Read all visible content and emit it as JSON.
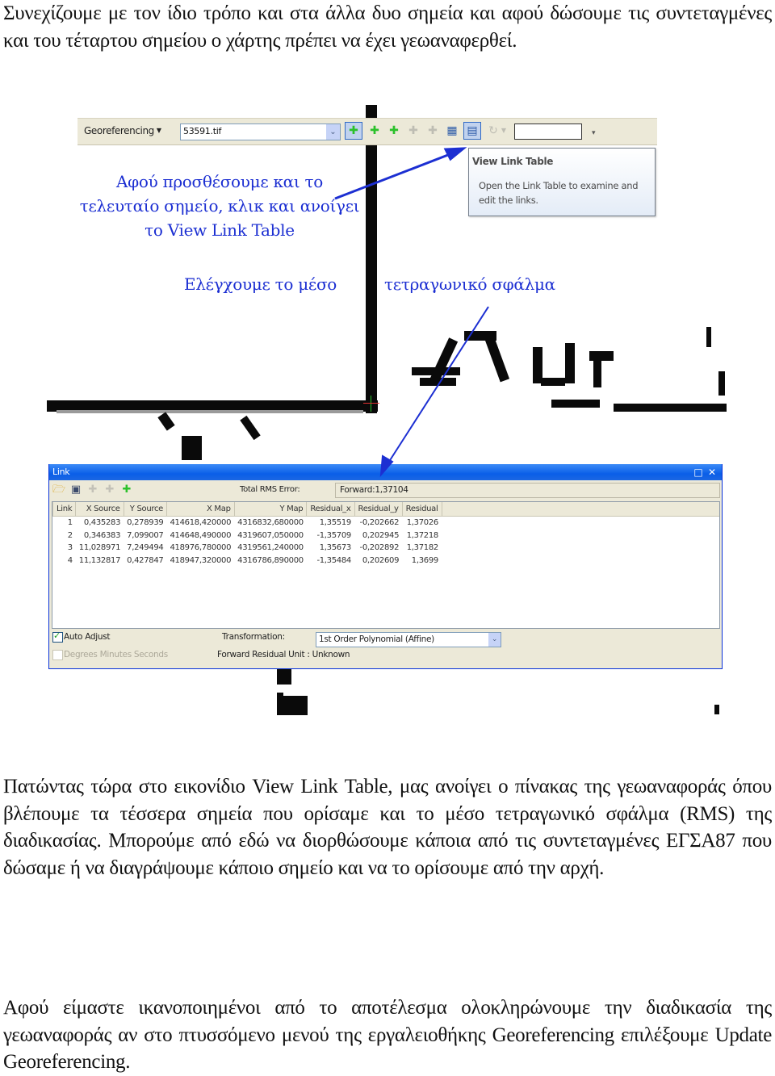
{
  "paragraphs": {
    "intro": "Συνεχίζουμε με τον ίδιο τρόπο και στα άλλα δυο σημεία και αφού δώσουμε τις συντεταγμένες και του τέταρτου σημείου ο χάρτης πρέπει να έχει γεωαναφερθεί.",
    "middle": "Πατώντας τώρα στο εικονίδιο View Link Table, μας ανοίγει ο πίνακας της γεωαναφοράς όπου βλέπουμε τα τέσσερα σημεία που ορίσαμε και το μέσο τετραγωνικό σφάλμα  (RMS) της διαδικασίας. Μπορούμε από εδώ να διορθώσουμε κάποια από τις συντεταγμένες ΕΓΣΑ87 που δώσαμε ή να διαγράψουμε κάποιο σημείο και να το ορίσουμε από την αρχή.",
    "final": "Αφού είμαστε ικανοποιημένοι από το αποτέλεσμα ολοκληρώνουμε την διαδικασία της γεωαναφοράς αν στο πτυσσόμενο μενού της εργαλειοθήκης Georeferencing επιλέξουμε Update Georeferencing."
  },
  "toolbar": {
    "menu_label": "Georeferencing",
    "layer_value": "53591.tif",
    "buttons": [
      {
        "name": "add-control-points",
        "icon": "add-control-points-icon",
        "glyph": "✚",
        "state": "active"
      },
      {
        "name": "auto-registration",
        "icon": "auto-registration-icon",
        "glyph": "✚",
        "state": "normal"
      },
      {
        "name": "select-link",
        "icon": "select-link-icon",
        "glyph": "✚",
        "state": "normal"
      },
      {
        "name": "zoom-to-selected-link",
        "icon": "zoom-to-link-icon",
        "glyph": "✚",
        "state": "disabled"
      },
      {
        "name": "delete-link",
        "icon": "delete-link-icon",
        "glyph": "✚",
        "state": "disabled"
      },
      {
        "name": "viewer",
        "icon": "viewer-icon",
        "glyph": "▦",
        "state": "normal"
      },
      {
        "name": "view-link-table",
        "icon": "link-table-icon",
        "glyph": "▤",
        "state": "active"
      },
      {
        "name": "rotate",
        "icon": "rotate-icon",
        "glyph": "↻",
        "state": "disabled"
      }
    ],
    "text_box_value": ""
  },
  "tooltip": {
    "title": "View Link Table",
    "body": "Open the Link Table to examine and edit the links."
  },
  "annotations": {
    "add_point": "Αφού προσθέσουμε και το τελευταίο σημείο, κλικ και ανοίγει το View Link Table",
    "check_rms_part1": "Ελέγχουμε το μέσο",
    "check_rms_part2": "τετραγωνικό σφάλμα",
    "color": "#1c2fd2"
  },
  "link_dialog": {
    "title": "Link",
    "total_rms_label": "Total RMS Error:",
    "total_rms_value": "Forward:1,37104",
    "columns": [
      "Link",
      "X Source",
      "Y Source",
      "X Map",
      "Y Map",
      "Residual_x",
      "Residual_y",
      "Residual"
    ],
    "rows": [
      [
        "1",
        "0,435283",
        "0,278939",
        "414618,420000",
        "4316832,680000",
        "1,35519",
        "-0,202662",
        "1,37026"
      ],
      [
        "2",
        "0,346383",
        "7,099007",
        "414648,490000",
        "4319607,050000",
        "-1,35709",
        "0,202945",
        "1,37218"
      ],
      [
        "3",
        "11,028971",
        "7,249494",
        "418976,780000",
        "4319561,240000",
        "1,35673",
        "-0,202892",
        "1,37182"
      ],
      [
        "4",
        "11,132817",
        "0,427847",
        "418947,320000",
        "4316786,890000",
        "-1,35484",
        "0,202609",
        "1,3699"
      ]
    ],
    "auto_adjust_label": "Auto Adjust",
    "auto_adjust_checked": true,
    "dms_label": "Degrees Minutes Seconds",
    "dms_checked": false,
    "transformation_label": "Transformation:",
    "transformation_value": "1st Order Polynomial (Affine)",
    "residual_unit_text": "Forward Residual Unit : Unknown",
    "title_bar_color": "#0a5ee8"
  }
}
